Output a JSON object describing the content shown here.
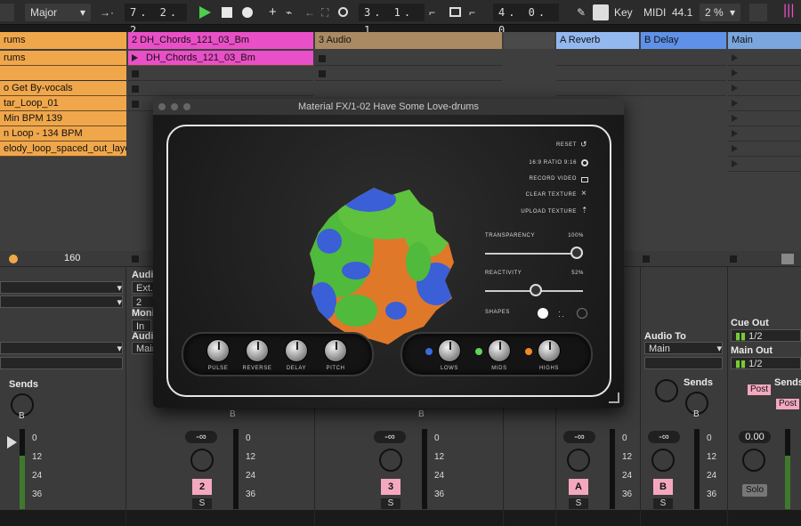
{
  "topbar": {
    "scale": "Major",
    "groove": "7. 2. 2",
    "position": "3. 1. 1",
    "loop_length": "4. 0. 0",
    "key_label": "Key",
    "midi_label": "MIDI",
    "cpu_value": "44.1",
    "zoom": "2 %"
  },
  "tracks": {
    "headers": [
      {
        "label": "rums",
        "color": "#f0a74b"
      },
      {
        "label": "2 DH_Chords_121_03_Bm",
        "color": "#e94fc7"
      },
      {
        "label": "3 Audio",
        "color": "#a98a62"
      },
      {
        "label": "",
        "color": "#4a4a4a"
      },
      {
        "label": "A Reverb",
        "color": "#93b8ef"
      },
      {
        "label": "B Delay",
        "color": "#5f91e8"
      },
      {
        "label": "Main",
        "color": "#7aa6dd"
      }
    ],
    "clips_track1": [
      "rums",
      "o Get By-vocals",
      "tar_Loop_01",
      "Min BPM 139",
      "n Loop - 134 BPM",
      "elody_loop_spaced_out_laye"
    ],
    "clip_track2": "DH_Chords_121_03_Bm",
    "tempo_value": "160"
  },
  "mixer": {
    "audio_from": "Audio",
    "ext": "Ext.",
    "input_channel": "2",
    "monitor": "Moni",
    "monitor_in": "In",
    "audio_to": "Audio",
    "audio_to_dest": "Main",
    "sends_label": "Sends",
    "send_a": "A",
    "send_b": "B",
    "vol_strips": [
      "-∞",
      "-∞",
      "-∞",
      "-∞",
      "0.00"
    ],
    "track_numbers": [
      "2",
      "3",
      "A",
      "B"
    ],
    "scale": [
      "0",
      "12",
      "24",
      "36"
    ],
    "solo_label": "S",
    "solo_main": "Solo",
    "main_audio_to": "Audio To",
    "main_dest": "Main",
    "cue_out": "Cue Out",
    "cue_val": "1/2",
    "main_out": "Main Out",
    "main_val": "1/2",
    "post_label": "Post"
  },
  "plugin": {
    "title": "Material FX/1-02 Have Some Love-drums",
    "controls": {
      "reset": "RESET",
      "ratio": "16:9 RATIO 9:16",
      "record": "RECORD VIDEO",
      "clear": "CLEAR TEXTURE",
      "upload": "UPLOAD TEXTURE"
    },
    "transparency_label": "TRANSPARENCY",
    "transparency_value": "100%",
    "transparency": 1.0,
    "reactivity_label": "REACTIVITY",
    "reactivity_value": "52%",
    "reactivity": 0.52,
    "shapes_label": "SHAPES",
    "fx_knobs": [
      "PULSE",
      "REVERSE",
      "DELAY",
      "PITCH"
    ],
    "eq_knobs": [
      {
        "label": "LOWS",
        "color": "#3a6be0"
      },
      {
        "label": "MIDS",
        "color": "#5fd35a"
      },
      {
        "label": "HIGHS",
        "color": "#ee8a2a"
      }
    ]
  }
}
